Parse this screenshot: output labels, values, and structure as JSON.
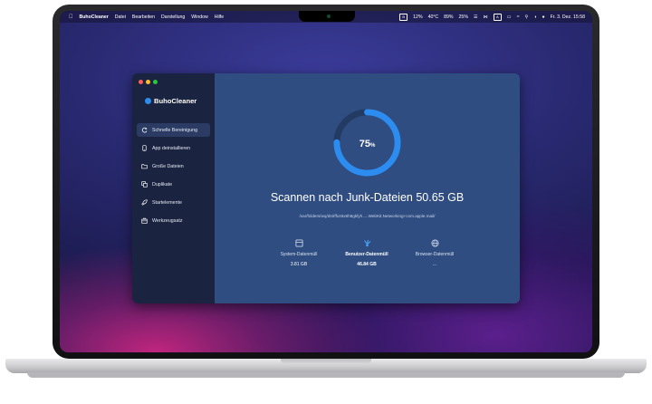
{
  "menubar": {
    "app_name": "BuhoCleaner",
    "menus": [
      "Datei",
      "Bearbeiten",
      "Darstellung",
      "Window",
      "Hilfe"
    ],
    "status": [
      "12%",
      "40°C",
      "89%",
      "25%"
    ],
    "datetime": "Fr. 3. Dez.  15:58"
  },
  "app": {
    "name": "BuhoCleaner",
    "sidebar": [
      {
        "label": "Schnelle Bereinigung",
        "icon": "cleanup-icon",
        "active": true
      },
      {
        "label": "App deinstallieren",
        "icon": "app-uninstall-icon",
        "active": false
      },
      {
        "label": "Große Dateien",
        "icon": "folder-icon",
        "active": false
      },
      {
        "label": "Duplikate",
        "icon": "duplicate-icon",
        "active": false
      },
      {
        "label": "Startelemente",
        "icon": "rocket-icon",
        "active": false
      },
      {
        "label": "Werkzeugsatz",
        "icon": "toolbox-icon",
        "active": false
      }
    ],
    "scan": {
      "progress": 75,
      "progress_label": "75",
      "progress_unit": "%",
      "title": "Scannen nach Junk-Dateien",
      "size": "50.65 GB",
      "path": "/var/folders/wq/dstrffx46x8h9gkfyh.....WebKit.Networking+com.apple.mail/"
    },
    "stats": [
      {
        "label": "System-Datenmüll",
        "value": "3.81 GB",
        "icon": "system-trash-icon"
      },
      {
        "label": "Benutzer-Datenmüll",
        "value": "46.84 GB",
        "icon": "user-trash-icon"
      },
      {
        "label": "Browser-Datenmüll",
        "value": "...",
        "icon": "globe-icon"
      }
    ]
  },
  "colors": {
    "accent": "#2d8cf0",
    "main_bg": "#2f4d80",
    "sidebar_bg": "#1a2340"
  }
}
